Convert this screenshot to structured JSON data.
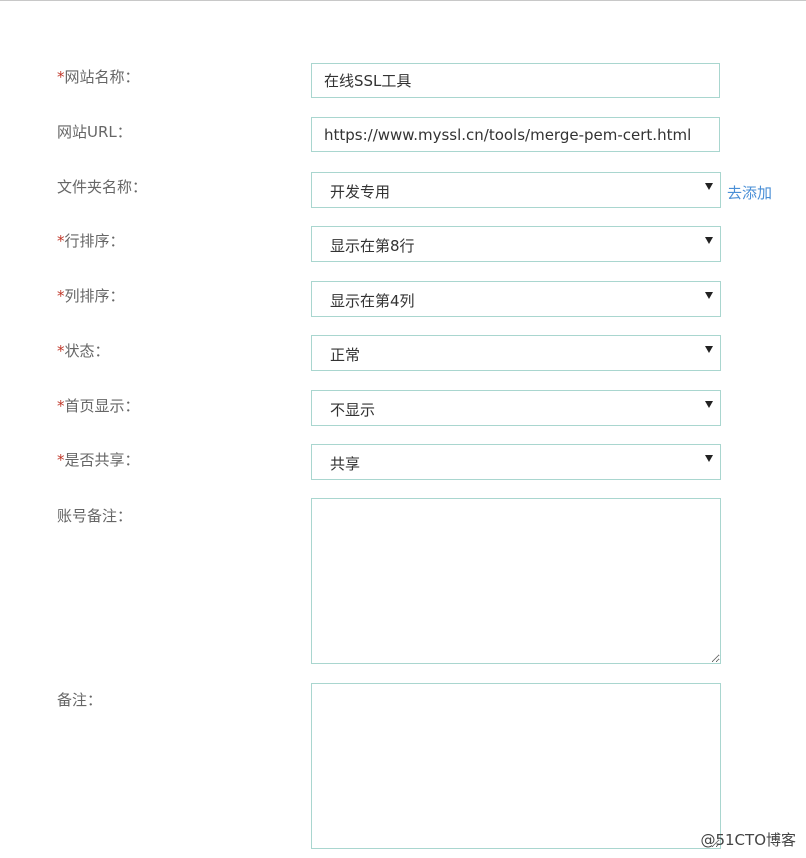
{
  "form": {
    "site_name": {
      "required": "*",
      "label": "网站名称：",
      "value": "在线SSL工具"
    },
    "site_url": {
      "label": "网站URL：",
      "value": "https://www.myssl.cn/tools/merge-pem-cert.html"
    },
    "folder": {
      "label": "文件夹名称：",
      "value": "开发专用",
      "add_link": "去添加"
    },
    "row_order": {
      "required": "*",
      "label": "行排序：",
      "value": "显示在第8行"
    },
    "col_order": {
      "required": "*",
      "label": "列排序：",
      "value": "显示在第4列"
    },
    "status": {
      "required": "*",
      "label": "状态：",
      "value": "正常"
    },
    "homepage": {
      "required": "*",
      "label": "首页显示：",
      "value": "不显示"
    },
    "shared": {
      "required": "*",
      "label": "是否共享：",
      "value": "共享"
    },
    "account_note": {
      "label": "账号备注：",
      "value": ""
    },
    "note": {
      "label": "备注：",
      "value": ""
    }
  },
  "watermark": "@51CTO博客",
  "colors": {
    "border": "#a9d6cf",
    "required": "#c0392b",
    "link": "#4a8fd6"
  }
}
